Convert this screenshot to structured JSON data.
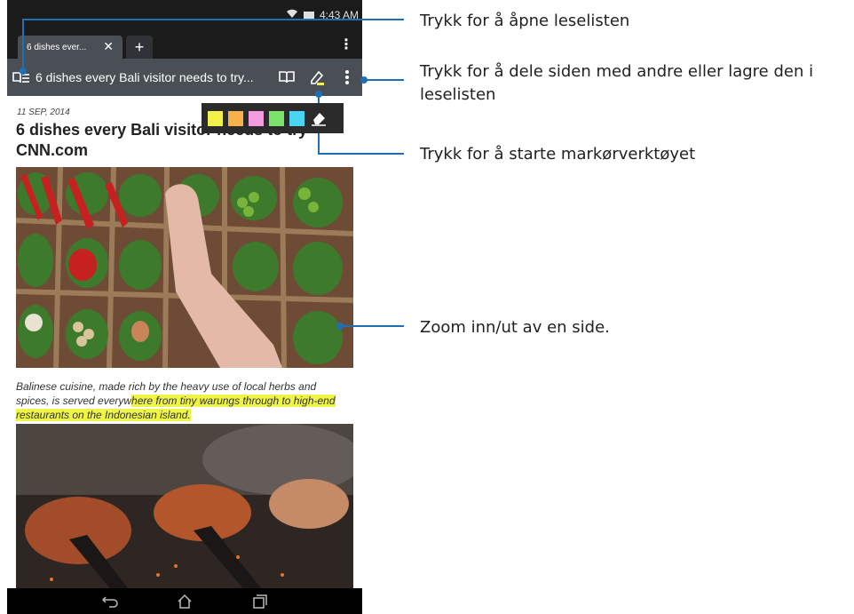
{
  "status_bar": {
    "time": "4:43 AM"
  },
  "tabs": [
    {
      "label": "6 dishes ever..."
    }
  ],
  "toolbar": {
    "page_title": "6 dishes every Bali visitor needs to try..."
  },
  "article": {
    "date": "11 SEP, 2014",
    "headline": "6 dishes every Bali visitor needs to try CNN.com",
    "caption_plain": "Balinese cuisine, made rich by the heavy use of local herbs and spices, is served everyw",
    "caption_highlighted": "here from tiny warungs through to high-end restaurants on the Indonesian island."
  },
  "marker_colors": [
    "#f2f14a",
    "#f7b24a",
    "#f49be0",
    "#7ce36a",
    "#4ad6f2"
  ],
  "callouts": {
    "reading_list": "Trykk for å åpne leselisten",
    "share_save": "Trykk for å dele siden med andre eller lagre den i leselisten",
    "marker_tool": "Trykk for å starte markørverktøyet",
    "zoom": "Zoom inn/ut av en side."
  },
  "colors": {
    "callout_line": "#1f6fb2",
    "toolbar": "#4a4f55",
    "highlight": "#eef547"
  },
  "icons": [
    "wifi-icon",
    "battery-icon",
    "tab-close-icon",
    "new-tab-icon",
    "overflow-menu-icon",
    "reading-list-icon",
    "reader-mode-icon",
    "marker-pen-icon",
    "eraser-icon",
    "back-icon",
    "home-icon",
    "recent-apps-icon"
  ]
}
